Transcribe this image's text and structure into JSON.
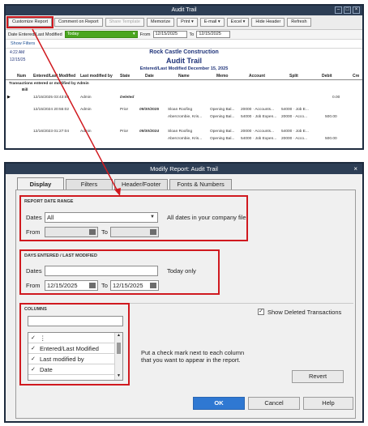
{
  "audit": {
    "title": "Audit Trail",
    "toolbar": [
      "Customize Report",
      "Comment on Report",
      "Share Template",
      "Memorize",
      "Print",
      "E-mail",
      "Excel",
      "Hide Header",
      "Refresh"
    ],
    "date_label": "Date Entered/Last Modified",
    "date_value": "Today",
    "from_label": "From",
    "from_value": "12/15/2025",
    "to_label": "To",
    "to_value": "12/15/2025",
    "show_filters": "Show Filters",
    "time": "4:22 AM",
    "date_small": "12/15/25",
    "company": "Rock Castle Construction",
    "report_title": "Audit Trail",
    "report_sub": "Entered/Last Modified December 15, 2025",
    "cols": [
      "Num",
      "Entered/Last Modified",
      "Last modified by",
      "State",
      "Date",
      "Name",
      "Memo",
      "Account",
      "Split",
      "Debit",
      "Cre"
    ],
    "section": "Transactions entered or modified by Admin",
    "section2": "Bill",
    "rows": [
      [
        "12/15/2025 03:43:59",
        "Admin",
        "Deleted",
        "",
        "",
        "",
        "",
        "",
        "0.00"
      ],
      [
        "12/15/2024 20:55:02",
        "Admin",
        "Prior",
        "09/30/2025",
        "Sloan Roofing",
        "Opening Bal...",
        "20000 · Accounts...",
        "54000 · Job E...",
        ""
      ],
      [
        "",
        "",
        "",
        "",
        "Abercrombie, Kris...",
        "Opening Bal...",
        "54000 · Job Expen...",
        "20000 · Acco...",
        "500.00"
      ],
      [
        "12/16/2023 01:27:04",
        "Admin",
        "Prior",
        "09/30/2024",
        "Sloan Roofing",
        "Opening Bal...",
        "20000 · Accounts...",
        "54000 · Job E...",
        ""
      ],
      [
        "",
        "",
        "",
        "",
        "Abercrombie, Kris...",
        "Opening Bal...",
        "54000 · Job Expen...",
        "20000 · Acco...",
        "500.00"
      ]
    ]
  },
  "modify": {
    "title": "Modify Report: Audit Trail",
    "tabs": [
      "Display",
      "Filters",
      "Header/Footer",
      "Fonts & Numbers"
    ],
    "range_title": "REPORT DATE RANGE",
    "dates_label": "Dates",
    "dates_value": "All",
    "dates_note": "All dates in your company file",
    "from_label": "From",
    "to_label": "To",
    "days_title": "DAYS ENTERED / LAST MODIFIED",
    "dates2_value": "Today",
    "dates2_note": "Today only",
    "from_value": "12/15/2025",
    "to_value": "12/15/2025",
    "columns_title": "COLUMNS",
    "columns": [
      {
        "checked": true,
        "label": ""
      },
      {
        "checked": true,
        "label": "Entered/Last Modified"
      },
      {
        "checked": true,
        "label": "Last modified by"
      },
      {
        "checked": true,
        "label": "Date"
      }
    ],
    "help_text": "Put a check mark next to each column that you want to appear in the report.",
    "show_deleted": "Show Deleted Transactions",
    "revert": "Revert",
    "ok": "OK",
    "cancel": "Cancel",
    "help": "Help"
  }
}
